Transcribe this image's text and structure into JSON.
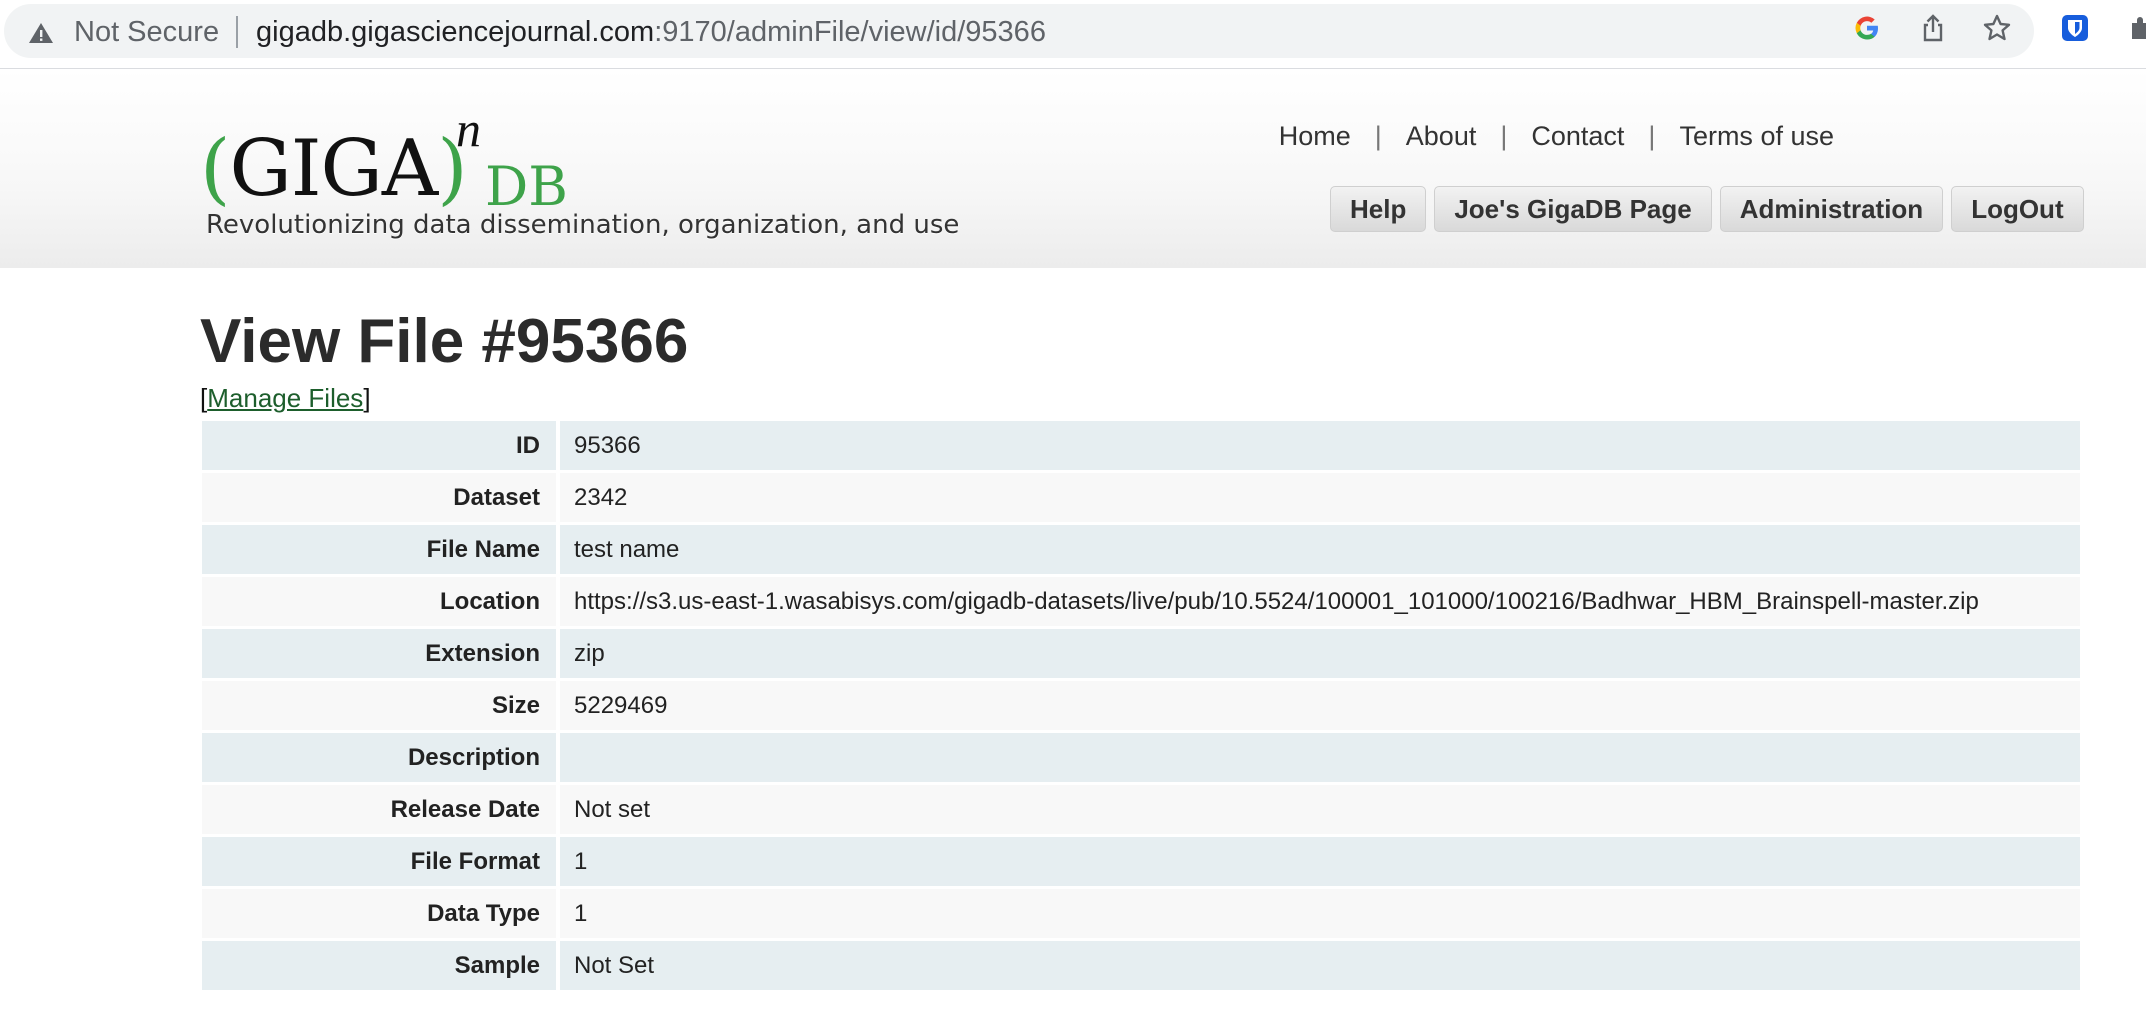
{
  "browser": {
    "security_label": "Not Secure",
    "url_host": "gigadb.gigasciencejournal.com",
    "url_rest": ":9170/adminFile/view/id/95366"
  },
  "header": {
    "logo_left": "(GIGA)",
    "logo_sup": "n",
    "logo_db": "DB",
    "tagline": "Revolutionizing data dissemination, organization, and use",
    "top_links": [
      "Home",
      "About",
      "Contact",
      "Terms of use"
    ],
    "buttons": [
      "Help",
      "Joe's GigaDB Page",
      "Administration",
      "LogOut"
    ]
  },
  "main": {
    "title": "View File #95366",
    "manage_link": "Manage Files"
  },
  "detail": [
    {
      "label": "ID",
      "value": "95366"
    },
    {
      "label": "Dataset",
      "value": "2342"
    },
    {
      "label": "File Name",
      "value": "test name"
    },
    {
      "label": "Location",
      "value": "https://s3.us-east-1.wasabisys.com/gigadb-datasets/live/pub/10.5524/100001_101000/100216/Badhwar_HBM_Brainspell-master.zip"
    },
    {
      "label": "Extension",
      "value": "zip"
    },
    {
      "label": "Size",
      "value": "5229469"
    },
    {
      "label": "Description",
      "value": ""
    },
    {
      "label": "Release Date",
      "value": "Not set"
    },
    {
      "label": "File Format",
      "value": "1"
    },
    {
      "label": "Data Type",
      "value": "1"
    },
    {
      "label": "Sample",
      "value": "Not Set"
    }
  ],
  "colors": {
    "accent_green": "#3ea34a",
    "link_green": "#1d5e2c",
    "not_set_pink": "#f3b7bd",
    "row_blue": "#e6eef1"
  }
}
